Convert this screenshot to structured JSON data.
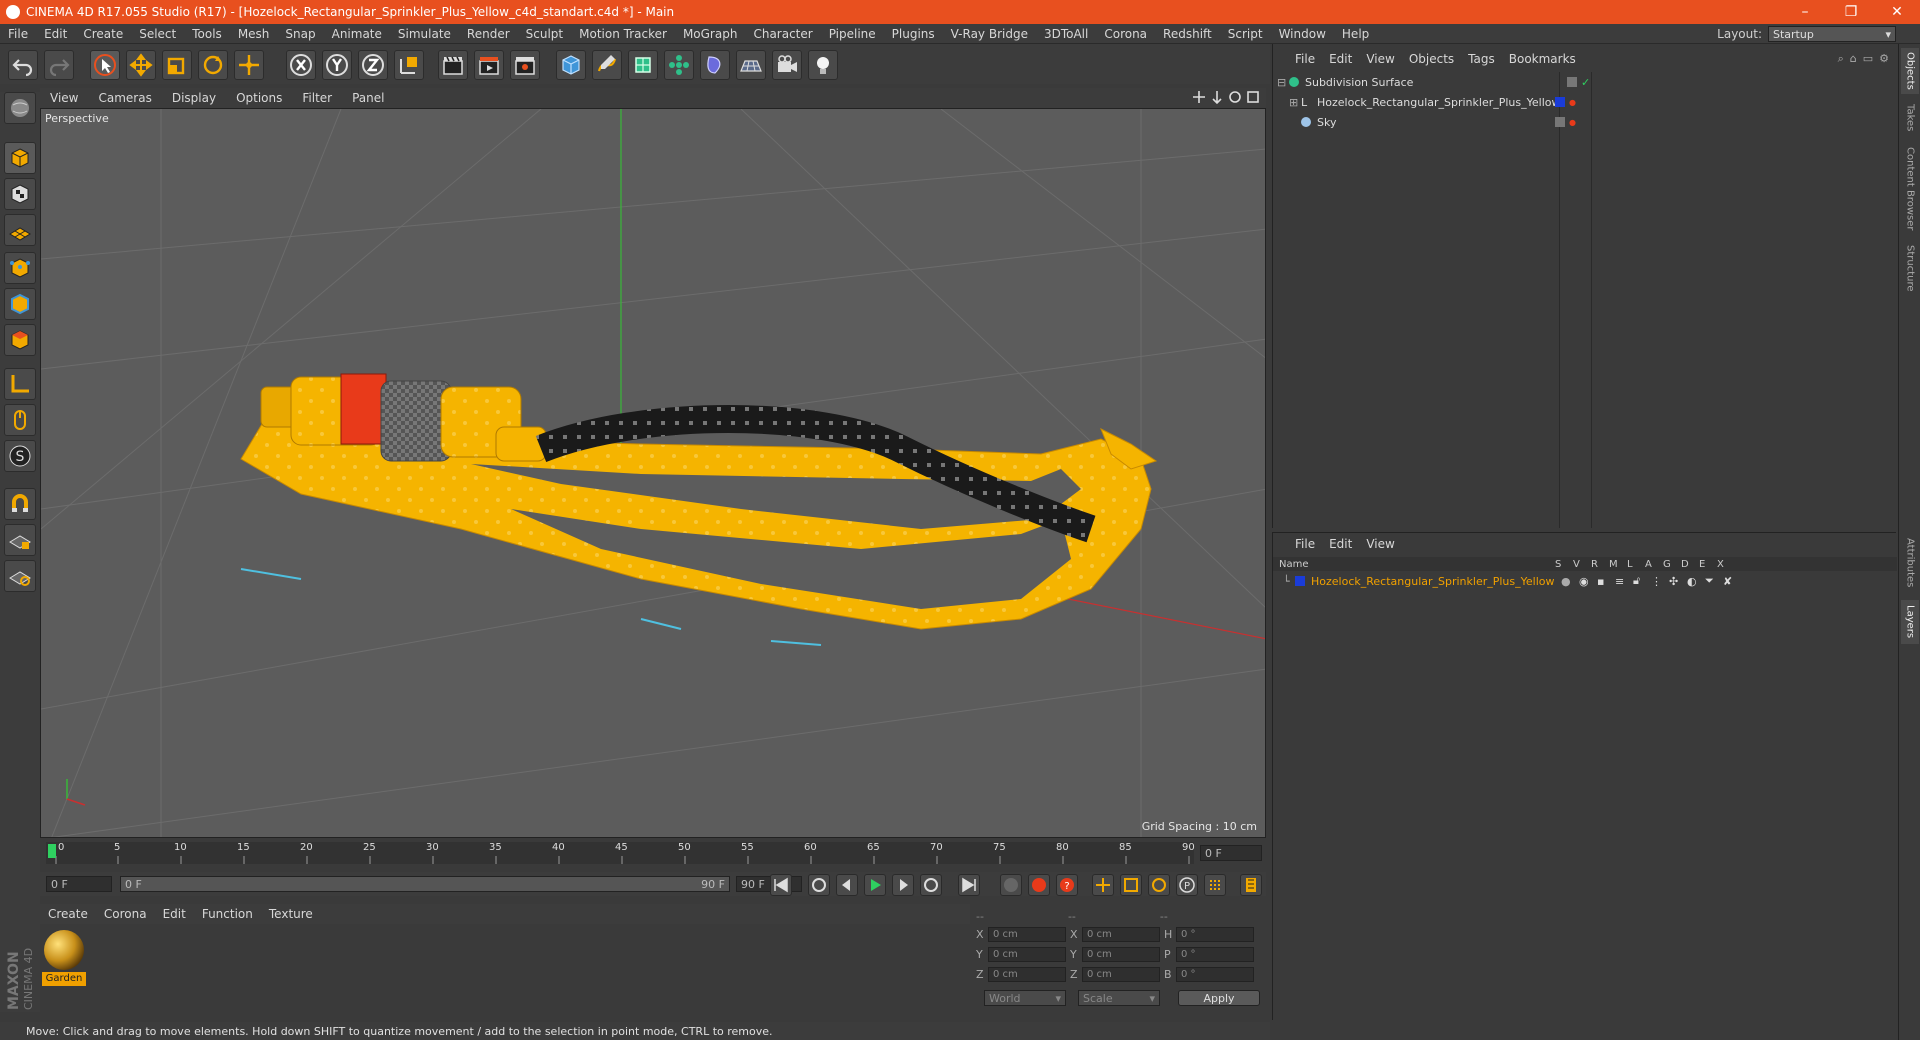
{
  "title": {
    "text": "CINEMA 4D R17.055 Studio (R17) - [Hozelock_Rectangular_Sprinkler_Plus_Yellow_c4d_standart.c4d *] - Main",
    "minimize": "–",
    "maximize": "❐",
    "close": "✕"
  },
  "menu": [
    "File",
    "Edit",
    "Create",
    "Select",
    "Tools",
    "Mesh",
    "Snap",
    "Animate",
    "Simulate",
    "Render",
    "Sculpt",
    "Motion Tracker",
    "MoGraph",
    "Character",
    "Pipeline",
    "Plugins",
    "V-Ray Bridge",
    "3DToAll",
    "Corona",
    "Redshift",
    "Script",
    "Window",
    "Help"
  ],
  "layout": {
    "label": "Layout:",
    "value": "Startup"
  },
  "viewport": {
    "menu": [
      "View",
      "Cameras",
      "Display",
      "Options",
      "Filter",
      "Panel"
    ],
    "label": "Perspective",
    "grid_spacing": "Grid Spacing : 10 cm"
  },
  "timeline": {
    "ticks": [
      "0",
      "5",
      "10",
      "15",
      "20",
      "25",
      "30",
      "35",
      "40",
      "45",
      "50",
      "55",
      "60",
      "65",
      "70",
      "75",
      "80",
      "85",
      "90"
    ],
    "current": "0 F"
  },
  "anim": {
    "start": "0 F",
    "range_start": "0 F",
    "range_end": "90 F",
    "end": "90 F"
  },
  "material_manager": {
    "menu": [
      "Create",
      "Corona",
      "Edit",
      "Function",
      "Texture"
    ],
    "materials": [
      {
        "name": "Garden"
      }
    ]
  },
  "coordinates": {
    "header": [
      "--",
      "--",
      "--"
    ],
    "rows": [
      {
        "a": "X",
        "av": "0 cm",
        "b": "X",
        "bv": "0 cm",
        "c": "H",
        "cv": "0 °"
      },
      {
        "a": "Y",
        "av": "0 cm",
        "b": "Y",
        "bv": "0 cm",
        "c": "P",
        "cv": "0 °"
      },
      {
        "a": "Z",
        "av": "0 cm",
        "b": "Z",
        "bv": "0 cm",
        "c": "B",
        "cv": "0 °"
      }
    ],
    "mode": "World",
    "type": "Scale",
    "apply": "Apply"
  },
  "status": "Move: Click and drag to move elements. Hold down SHIFT to quantize movement / add to the selection in point mode, CTRL to remove.",
  "object_manager": {
    "menu": [
      "File",
      "Edit",
      "View",
      "Objects",
      "Tags",
      "Bookmarks"
    ],
    "objects": [
      {
        "name": "Subdivision Surface",
        "color": "#2fc08a"
      },
      {
        "name": "Hozelock_Rectangular_Sprinkler_Plus_Yellow",
        "color": "#1a3cd8"
      },
      {
        "name": "Sky",
        "color": "#9ec4e8"
      }
    ]
  },
  "layer_manager": {
    "menu": [
      "File",
      "Edit",
      "View"
    ],
    "columns": [
      "Name",
      "S",
      "V",
      "R",
      "M",
      "L",
      "A",
      "G",
      "D",
      "E",
      "X"
    ],
    "layers": [
      {
        "name": "Hozelock_Rectangular_Sprinkler_Plus_Yellow",
        "color": "#1a3cd8"
      }
    ]
  },
  "right_tabs": [
    "Objects",
    "Takes",
    "Content Browser",
    "Structure",
    "Attributes",
    "Layers"
  ],
  "brand": {
    "line1": "MAXON",
    "line2": "CINEMA 4D"
  },
  "colors": {
    "title_bar": "#e8501f",
    "accent": "#e8501f",
    "selected_material": "#f0a000"
  }
}
